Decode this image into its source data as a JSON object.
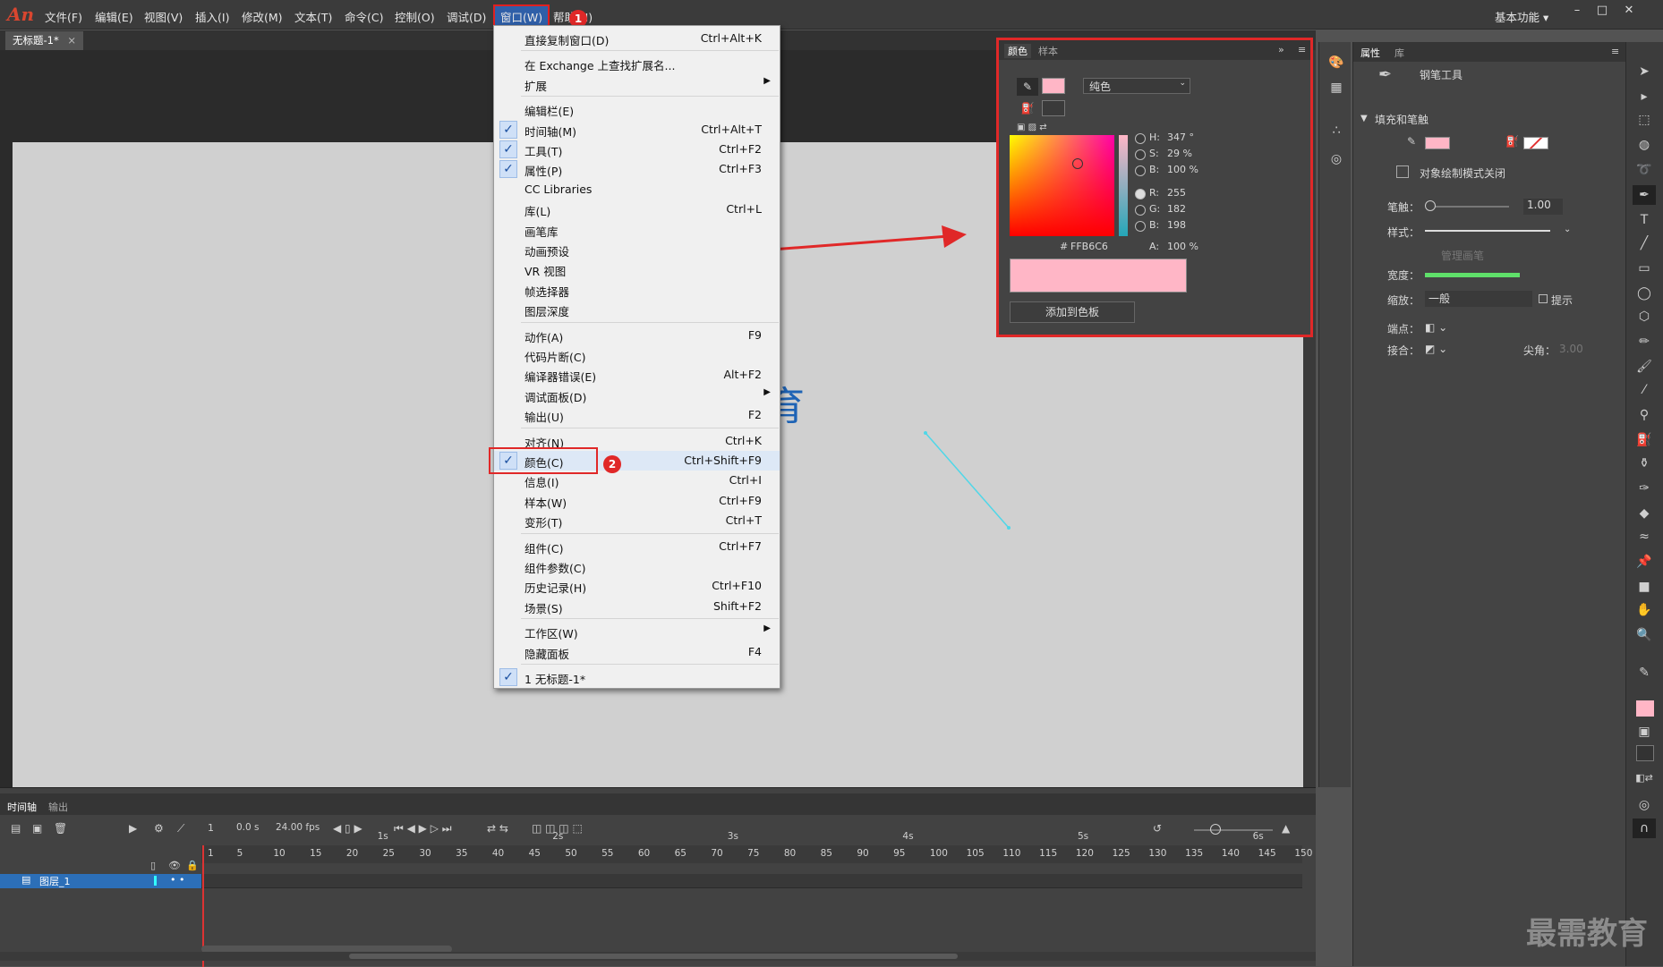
{
  "app": {
    "logo": "An",
    "workspace": "基本功能 ▾",
    "doc_tab": "无标题-1*",
    "doc_tab_close": "×"
  },
  "menu": [
    "文件(F)",
    "编辑(E)",
    "视图(V)",
    "插入(I)",
    "修改(M)",
    "文本(T)",
    "命令(C)",
    "控制(O)",
    "调试(D)",
    "窗口(W)",
    "帮助(H)"
  ],
  "stage_char": "育",
  "dropdown": [
    {
      "label": "直接复制窗口(D)",
      "shortcut": "Ctrl+Alt+K",
      "y": 0
    },
    {
      "sep": true
    },
    {
      "label": "在 Exchange 上查找扩展名...",
      "y": 1
    },
    {
      "label": "扩展",
      "sub": true
    },
    {
      "sep": true
    },
    {
      "label": "编辑栏(E)"
    },
    {
      "label": "时间轴(M)",
      "shortcut": "Ctrl+Alt+T",
      "checked": true
    },
    {
      "label": "工具(T)",
      "shortcut": "Ctrl+F2",
      "checked": true
    },
    {
      "label": "属性(P)",
      "shortcut": "Ctrl+F3",
      "checked": true
    },
    {
      "label": "CC Libraries"
    },
    {
      "label": "库(L)",
      "shortcut": "Ctrl+L"
    },
    {
      "label": "画笔库"
    },
    {
      "label": "动画预设"
    },
    {
      "label": "VR 视图"
    },
    {
      "label": "帧选择器"
    },
    {
      "label": "图层深度"
    },
    {
      "sep": true
    },
    {
      "label": "动作(A)",
      "shortcut": "F9"
    },
    {
      "label": "代码片断(C)"
    },
    {
      "label": "编译器错误(E)",
      "shortcut": "Alt+F2"
    },
    {
      "label": "调试面板(D)",
      "sub": true
    },
    {
      "label": "输出(U)",
      "shortcut": "F2"
    },
    {
      "sep": true
    },
    {
      "label": "对齐(N)",
      "shortcut": "Ctrl+K"
    },
    {
      "label": "颜色(C)",
      "shortcut": "Ctrl+Shift+F9",
      "checked": true,
      "highlight": true
    },
    {
      "label": "信息(I)",
      "shortcut": "Ctrl+I"
    },
    {
      "label": "样本(W)",
      "shortcut": "Ctrl+F9"
    },
    {
      "label": "变形(T)",
      "shortcut": "Ctrl+T"
    },
    {
      "sep": true
    },
    {
      "label": "组件(C)",
      "shortcut": "Ctrl+F7"
    },
    {
      "label": "组件参数(C)"
    },
    {
      "label": "历史记录(H)",
      "shortcut": "Ctrl+F10"
    },
    {
      "label": "场景(S)",
      "shortcut": "Shift+F2"
    },
    {
      "sep": true
    },
    {
      "label": "工作区(W)",
      "sub": true
    },
    {
      "label": "隐藏面板",
      "shortcut": "F4"
    },
    {
      "sep": true
    },
    {
      "label": "1 无标题-1*",
      "checked": true
    }
  ],
  "badges": {
    "one": "1",
    "two": "2"
  },
  "color_panel": {
    "tabs": [
      "颜色",
      "样本"
    ],
    "fill_type": "纯色",
    "h": "347 °",
    "s": "29 %",
    "b": "100 %",
    "r": "255",
    "g": "182",
    "bl": "198",
    "hex_label": "#",
    "hex": "FFB6C6",
    "alpha_label": "A:",
    "alpha": "100 %",
    "h_label": "H:",
    "s_label": "S:",
    "b_label": "B:",
    "r_label": "R:",
    "g_label": "G:",
    "bl_label": "B:",
    "add_swatch": "添加到色板",
    "color": "#FFB6C6"
  },
  "props": {
    "tabs": [
      "属性",
      "库"
    ],
    "tool_name": "钢笔工具",
    "section": "填充和笔触",
    "object_mode": "对象绘制模式关闭",
    "stroke_label": "笔触：",
    "stroke_value": "1.00",
    "style_label": "样式：",
    "manage": "管理画笔",
    "width_label": "宽度：",
    "scale_label": "缩放：",
    "scale_value": "一般",
    "hint": "提示",
    "cap_label": "端点：",
    "join_label": "接合：",
    "miter_label": "尖角：",
    "miter_value": "3.00"
  },
  "timeline": {
    "tabs": [
      "时间轴",
      "输出"
    ],
    "frame": "1",
    "time": "0.0 s",
    "fps": "24.00 fps",
    "layer": "图层_1",
    "seconds": [
      "1s",
      "2s",
      "3s",
      "4s",
      "5s",
      "6s"
    ],
    "frames": [
      "1",
      "5",
      "10",
      "15",
      "20",
      "25",
      "30",
      "35",
      "40",
      "45",
      "50",
      "55",
      "60",
      "65",
      "70",
      "75",
      "80",
      "85",
      "90",
      "95",
      "100",
      "105",
      "110",
      "115",
      "120",
      "125",
      "130",
      "135",
      "140",
      "145",
      "150"
    ]
  },
  "watermark": "最需教育"
}
